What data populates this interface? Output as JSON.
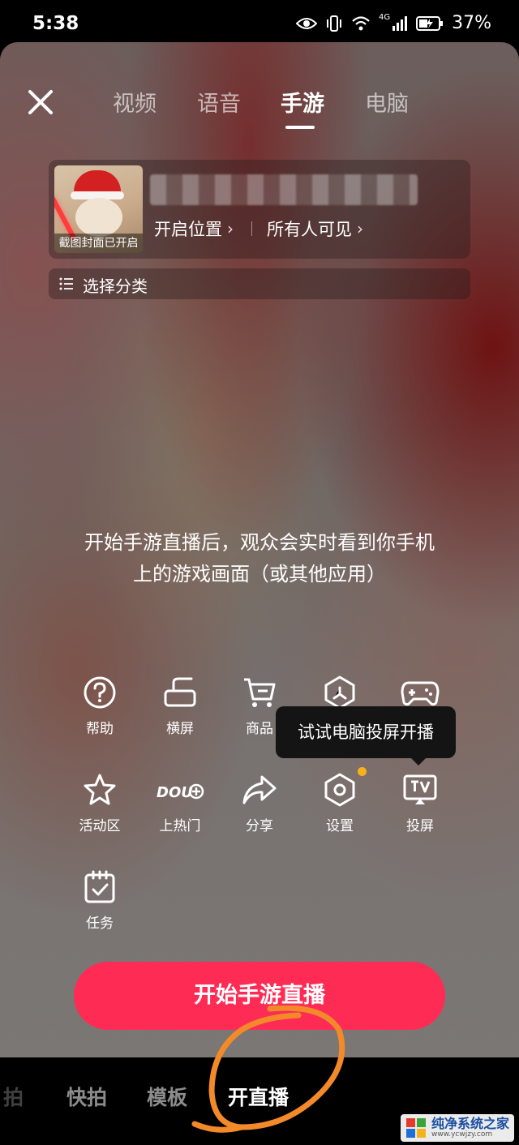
{
  "status_bar": {
    "time": "5:38",
    "network": "4G",
    "battery": "37%"
  },
  "tabs": [
    {
      "label": "视频",
      "active": false
    },
    {
      "label": "语音",
      "active": false
    },
    {
      "label": "手游",
      "active": true
    },
    {
      "label": "电脑",
      "active": false
    }
  ],
  "info_card": {
    "cover_caption": "截图封面已开启",
    "location_label": "开启位置",
    "visibility_label": "所有人可见"
  },
  "category": {
    "label": "选择分类"
  },
  "description": "开始手游直播后，观众会实时看到你手机上的游戏画面（或其他应用）",
  "tools": [
    {
      "label": "帮助",
      "icon": "help-icon"
    },
    {
      "label": "横屏",
      "icon": "landscape-icon"
    },
    {
      "label": "商品",
      "icon": "cart-icon"
    },
    {
      "label": "",
      "icon": "aperture-icon"
    },
    {
      "label": "",
      "icon": "gamepad-icon"
    },
    {
      "label": "活动区",
      "icon": "star-icon"
    },
    {
      "label": "上热门",
      "icon": "dou-plus-icon"
    },
    {
      "label": "分享",
      "icon": "share-icon"
    },
    {
      "label": "设置",
      "icon": "settings-icon"
    },
    {
      "label": "投屏",
      "icon": "tv-cast-icon"
    },
    {
      "label": "任务",
      "icon": "task-icon"
    }
  ],
  "tooltip": {
    "text": "试试电脑投屏开播"
  },
  "start_button": {
    "label": "开始手游直播"
  },
  "bottom_modes": [
    {
      "label": "拍",
      "active": false
    },
    {
      "label": "快拍",
      "active": false
    },
    {
      "label": "模板",
      "active": false
    },
    {
      "label": "开直播",
      "active": true
    }
  ],
  "watermark": {
    "name": "纯净系统之家",
    "url": "www.ycwjzy.com"
  },
  "colors": {
    "accent": "#fe2c55",
    "notify_dot": "#f7b11b",
    "annotation": "#f28a2a"
  }
}
